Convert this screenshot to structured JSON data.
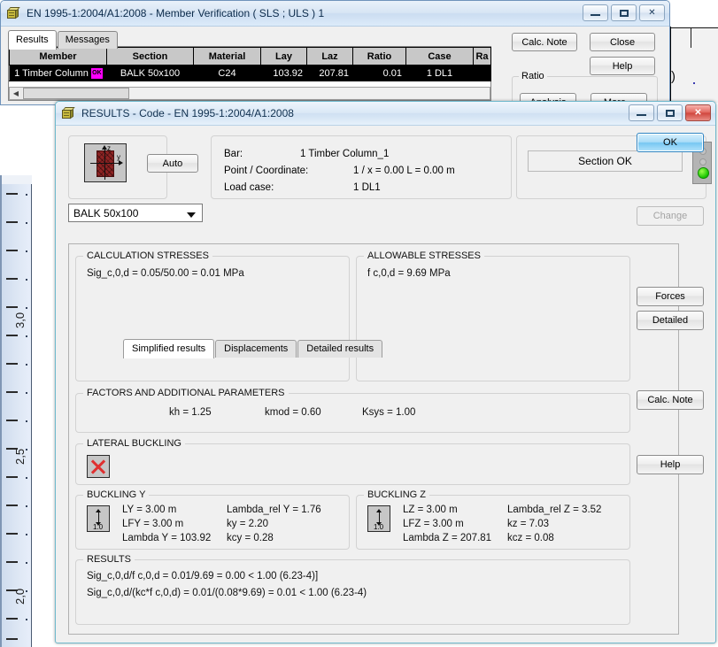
{
  "background_window": {
    "title": "EN 1995-1:2004/A1:2008 - Member Verification ( SLS ; ULS ) 1",
    "icon": "box-icon",
    "window_buttons": {
      "minimize": "minimize-icon",
      "maximize": "maximize-icon",
      "close": "close-icon"
    },
    "tabs": [
      {
        "label": "Results",
        "active": true
      },
      {
        "label": "Messages",
        "active": false
      }
    ],
    "grid": {
      "columns": [
        "Member",
        "Section",
        "Material",
        "Lay",
        "Laz",
        "Ratio",
        "Case",
        "Ra"
      ],
      "rows": [
        {
          "member": "1  Timber Column",
          "status_badge": "OK",
          "section": "BALK 50x100",
          "material": "C24",
          "lay": "103.92",
          "laz": "207.81",
          "ratio": "0.01",
          "case": "1 DL1",
          "ra": ""
        }
      ]
    },
    "buttons": {
      "calc_note": "Calc. Note",
      "close": "Close",
      "help": "Help"
    },
    "ratio_group": {
      "legend": "Ratio",
      "analysis": "Analysis",
      "more": "More..."
    }
  },
  "ruler": {
    "labels": [
      "3,0",
      "2,5",
      "2,0"
    ]
  },
  "dialog": {
    "title": "RESULTS - Code - EN 1995-1:2004/A1:2008",
    "icon": "box-icon",
    "window_buttons": {
      "minimize": "minimize-icon",
      "maximize": "maximize-icon",
      "close": "close-icon"
    },
    "header": {
      "section_preview_icon": "cross-section-icon",
      "axis_z": "z",
      "axis_y": "y",
      "auto_button": "Auto",
      "section_combo_value": "BALK 50x100",
      "bar_label": "Bar:",
      "bar_value": "1  Timber Column_1",
      "point_label": "Point / Coordinate:",
      "point_value": "1 / x = 0.00 L = 0.00 m",
      "loadcase_label": "Load case:",
      "loadcase_value": "1 DL1",
      "status_text": "Section OK",
      "traffic_light": "green"
    },
    "tabs": [
      {
        "label": "Simplified results",
        "active": true
      },
      {
        "label": "Displacements",
        "active": false
      },
      {
        "label": "Detailed results",
        "active": false
      }
    ],
    "calculation_stresses": {
      "legend": "CALCULATION STRESSES",
      "lines": [
        "Sig_c,0,d = 0.05/50.00 = 0.01 MPa"
      ]
    },
    "allowable_stresses": {
      "legend": "ALLOWABLE STRESSES",
      "lines": [
        "f c,0,d = 9.69 MPa"
      ]
    },
    "factors": {
      "legend": "FACTORS AND ADDITIONAL PARAMETERS",
      "kh": "kh = 1.25",
      "kmod": "kmod = 0.60",
      "ksys": "Ksys = 1.00"
    },
    "lateral_buckling": {
      "legend": "LATERAL BUCKLING",
      "icon": "red-x-icon"
    },
    "buckling_y": {
      "legend": "BUCKLING Y",
      "icon": "buckling-length-icon",
      "icon_value": "1.0",
      "col1": [
        "LY = 3.00 m",
        "LFY = 3.00 m",
        "Lambda Y = 103.92"
      ],
      "col2": [
        "Lambda_rel Y = 1.76",
        "ky = 2.20",
        "kcy = 0.28"
      ]
    },
    "buckling_z": {
      "legend": "BUCKLING Z",
      "icon": "buckling-length-icon",
      "icon_value": "1.0",
      "col1": [
        "LZ = 3.00 m",
        "LFZ = 3.00 m",
        "Lambda Z = 207.81"
      ],
      "col2": [
        "Lambda_rel Z = 3.52",
        "kz = 7.03",
        "kcz = 0.08"
      ]
    },
    "results": {
      "legend": "RESULTS",
      "lines": [
        "Sig_c,0,d/f c,0,d = 0.01/9.69  = 0.00 < 1.00   (6.23-4)]",
        "Sig_c,0,d/(kc*f c,0,d) = 0.01/(0.08*9.69) = 0.01 < 1.00   (6.23-4)"
      ]
    },
    "side_buttons": {
      "ok": "OK",
      "change": "Change",
      "change_disabled": true,
      "forces": "Forces",
      "detailed": "Detailed",
      "calc_note": "Calc. Note",
      "help": "Help"
    }
  },
  "colors": {
    "accent_blue": "#76c7f2",
    "status_green": "#17c400",
    "badge_magenta": "#ff00ff",
    "section_red": "#8e2323",
    "grid_row_bg": "#000000",
    "dialog_bg": "#f0f0f0"
  }
}
